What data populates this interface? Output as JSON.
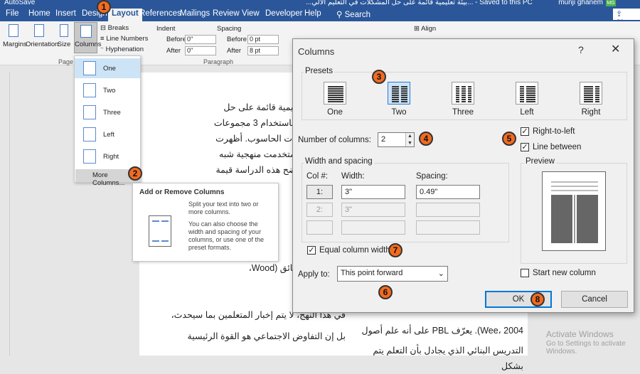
{
  "window": {
    "title_left": "AutoSave",
    "title_doc": "...بيئة تعليمية قائمة على حل المشكلات في التعليم الآلي... - Saved to this PC",
    "user": "munji ghanem",
    "user_initials": "MG"
  },
  "menu": {
    "tabs": [
      "File",
      "Home",
      "Insert",
      "Design",
      "Layout",
      "References",
      "Mailings",
      "Review",
      "View",
      "Developer",
      "Help"
    ],
    "active": "Layout",
    "search": "Search",
    "share": "Share"
  },
  "ribbon": {
    "margins": "Margins",
    "orientation": "Orientation",
    "size": "Size",
    "columns": "Columns",
    "breaks": "Breaks",
    "line_numbers": "Line Numbers",
    "hyphenation": "Hyphenation",
    "page_setup_group": "Page S",
    "indent": "Indent",
    "spacing": "Spacing",
    "before_label": "Before",
    "after_label": "After",
    "indent_before": "0\"",
    "indent_after": "0\"",
    "space_before": "0 pt",
    "space_after": "8 pt",
    "paragraph_group": "Paragraph",
    "align": "Align"
  },
  "columns_menu": {
    "items": [
      "One",
      "Two",
      "Three",
      "Left",
      "Right"
    ],
    "more": "More Columns..."
  },
  "tooltip": {
    "title": "Add or Remove Columns",
    "desc1": "Split your text into two or more columns.",
    "desc2": "You can also choose the width and spacing of your columns, or use one of the preset formats."
  },
  "document": {
    "lines": [
      "ض في بيئة تعليمية قائمة على حل",
      "سقالات وذلك باستخدام 3 مجموعات",
      "دام جداول بيانات الحاسوب. أظهرت",
      "جموعة التي استخدمت منهجية شبه",
      "عة الأخرى. توضح هذه الدراسة قيمة"
    ],
    "lines_b": [
      "بقوم",
      "طلوب",
      "مثل حفظ الحقائق (Wood،"
    ],
    "lines_c": [
      "في هذا النهج، لا يتم إخبار المتعلمين بما سيحدث،",
      "بل إن التفاوض الاجتماعي هو القوة الرئيسية"
    ],
    "col2_lines": [
      "Wee، 2004). يعرّف PBL على أنه علم أصول",
      "التدريس البنائي الذي يجادل بأن التعلم يتم بشكل"
    ]
  },
  "dialog": {
    "title": "Columns",
    "help": "?",
    "presets_label": "Presets",
    "presets": [
      "One",
      "Two",
      "Three",
      "Left",
      "Right"
    ],
    "selected_preset": "Two",
    "num_columns_label": "Number of columns:",
    "num_columns": "2",
    "right_to_left": "Right-to-left",
    "line_between": "Line between",
    "width_spacing_label": "Width and spacing",
    "col_header": "Col #:",
    "width_header": "Width:",
    "spacing_header": "Spacing:",
    "rows": [
      {
        "col": "1:",
        "width": "3\"",
        "spacing": "0.49\""
      },
      {
        "col": "2:",
        "width": "3\"",
        "spacing": ""
      }
    ],
    "equal_width": "Equal column width",
    "apply_to_label": "Apply to:",
    "apply_to": "This point forward",
    "preview_label": "Preview",
    "start_new_column": "Start new column",
    "ok": "OK",
    "cancel": "Cancel"
  },
  "badges": [
    "1",
    "2",
    "3",
    "4",
    "5",
    "6",
    "7",
    "8"
  ],
  "watermark": {
    "line1": "Activate Windows",
    "line2": "Go to Settings to activate Windows."
  },
  "colors": {
    "accent": "#2b579a",
    "badge": "#f36b1f",
    "ok_border": "#0078d7"
  }
}
